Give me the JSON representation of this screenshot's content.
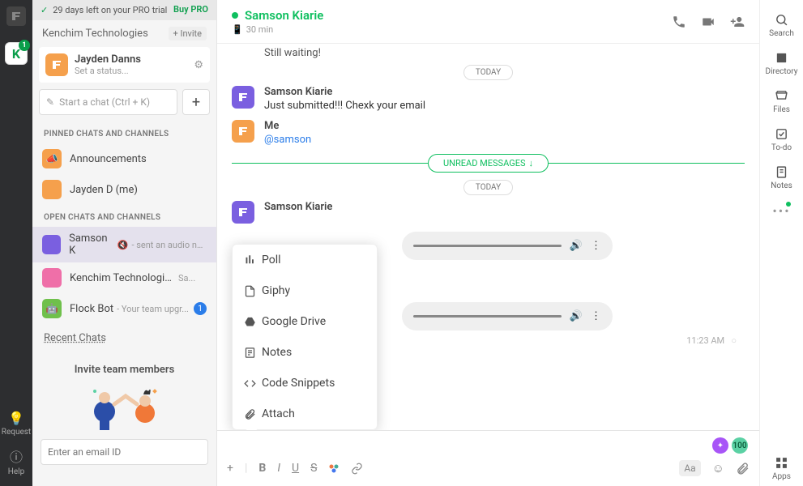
{
  "trial": {
    "text": "29 days left on your PRO trial",
    "buy": "Buy PRO"
  },
  "org": {
    "name": "Kenchim Technologies",
    "invite": "+ Invite",
    "badge": "K",
    "badgeCount": "1"
  },
  "user": {
    "name": "Jayden Danns",
    "status": "Set a status..."
  },
  "search": {
    "placeholder": "Start a chat (Ctrl + K)"
  },
  "sections": {
    "pinned": "PINNED CHATS AND CHANNELS",
    "open": "OPEN CHATS AND CHANNELS"
  },
  "pinned": [
    {
      "name": "Announcements",
      "color": "#f5a04c"
    },
    {
      "name": "Jayden D (me)",
      "color": "#f5a04c"
    }
  ],
  "open": [
    {
      "name": "Samson K",
      "sub": "- sent an audio note",
      "color": "#7a5fe0",
      "sel": true,
      "muted": true
    },
    {
      "name": "Kenchim Technologies Hub",
      "sub": "Sa...",
      "color": "#ef6fa8"
    },
    {
      "name": "Flock Bot",
      "sub": "- Your team upgr...",
      "color": "#6fc04b",
      "badge": "1"
    }
  ],
  "recent": "Recent Chats",
  "inviteBox": {
    "title": "Invite team members",
    "placeholder": "Enter an email ID"
  },
  "farLeft": {
    "request": "Request",
    "help": "Help"
  },
  "header": {
    "name": "Samson Kiarie",
    "sub": "30 min"
  },
  "messages": {
    "stillWaiting": "Still waiting!",
    "today": "TODAY",
    "m1": {
      "name": "Samson Kiarie",
      "text": "Just submitted!!! Chexk your email"
    },
    "m2": {
      "name": "Me",
      "text": "@samson"
    },
    "unread": "UNREAD MESSAGES",
    "m3": {
      "name": "Samson Kiarie"
    },
    "time": "11:23 AM"
  },
  "popup": [
    {
      "icon": "poll",
      "label": "Poll"
    },
    {
      "icon": "giphy",
      "label": "Giphy"
    },
    {
      "icon": "gdrive",
      "label": "Google Drive"
    },
    {
      "icon": "notes",
      "label": "Notes"
    },
    {
      "icon": "code",
      "label": "Code Snippets"
    },
    {
      "icon": "attach",
      "label": "Attach"
    }
  ],
  "composer": {
    "badge": "100",
    "aa": "Aa"
  },
  "right": [
    {
      "icon": "search",
      "label": "Search"
    },
    {
      "icon": "directory",
      "label": "Directory"
    },
    {
      "icon": "files",
      "label": "Files"
    },
    {
      "icon": "todo",
      "label": "To-do"
    },
    {
      "icon": "notes",
      "label": "Notes"
    }
  ],
  "apps": "Apps"
}
